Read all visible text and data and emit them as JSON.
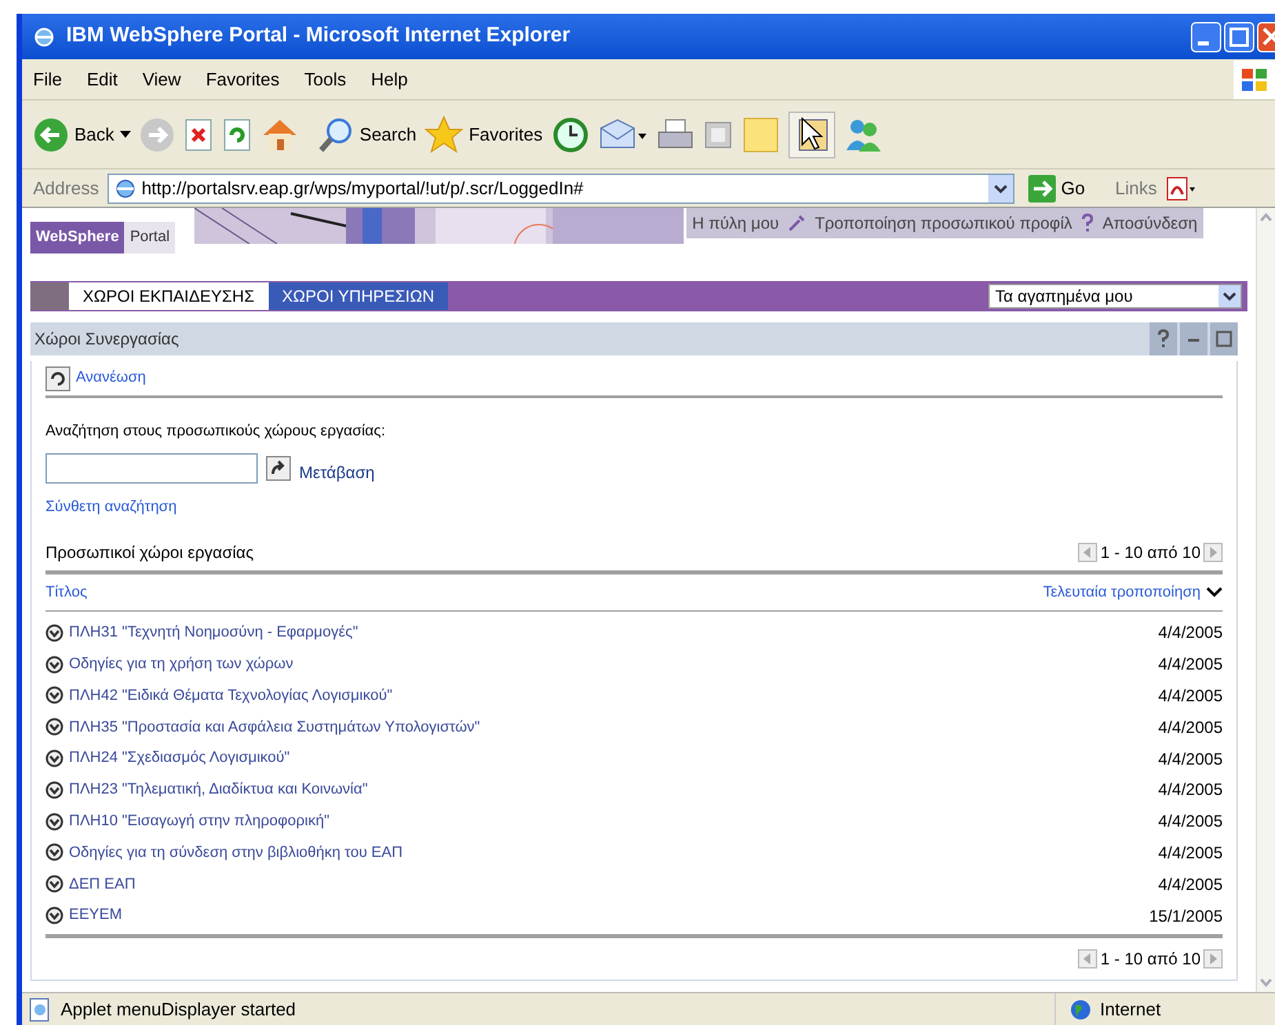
{
  "window": {
    "title": "IBM WebSphere Portal - Microsoft Internet Explorer"
  },
  "menu": [
    "File",
    "Edit",
    "View",
    "Favorites",
    "Tools",
    "Help"
  ],
  "toolbar": {
    "back": "Back",
    "search": "Search",
    "favorites": "Favorites"
  },
  "address_bar": {
    "label": "Address",
    "url": "http://portalsrv.eap.gr/wps/myportal/!ut/p/.scr/LoggedIn#",
    "go": "Go",
    "links": "Links"
  },
  "portal": {
    "brand": [
      "WebSphere",
      "Portal"
    ],
    "nav_links": [
      "Η πύλη μου",
      "Τροποποίηση προσωπικού προφίλ",
      "Αποσύνδεση"
    ],
    "tabs": [
      {
        "label": "ΧΩΡΟΙ ΕΚΠΑΙΔΕΥΣΗΣ",
        "selected": true
      },
      {
        "label": "ΧΩΡΟΙ ΥΠΗΡΕΣΙΩΝ",
        "selected": false
      }
    ],
    "favorites_dropdown": "Τα αγαπημένα μου"
  },
  "portlet": {
    "title": "Χώροι Συνεργασίας",
    "refresh": "Ανανέωση",
    "search_label": "Αναζήτηση στους προσωπικούς χώρους εργασίας:",
    "go": "Μετάβαση",
    "advanced_search": "Σύνθετη αναζήτηση",
    "section_title": "Προσωπικοί χώροι εργασίας",
    "pager_top": "1 - 10 από 10",
    "pager_bottom": "1 - 10 από 10",
    "columns": [
      "Τίτλος",
      "Τελευταία τροποποίηση"
    ],
    "rows": [
      {
        "title": "ΠΛΗ31 \"Τεχνητή Νοημοσύνη - Εφαρμογές\"",
        "modified": "4/4/2005"
      },
      {
        "title": "Οδηγίες για τη χρήση των χώρων",
        "modified": "4/4/2005"
      },
      {
        "title": "ΠΛΗ42 \"Ειδικά Θέματα Τεχνολογίας Λογισμικού\"",
        "modified": "4/4/2005"
      },
      {
        "title": "ΠΛΗ35 \"Προστασία και Ασφάλεια Συστημάτων Υπολογιστών\"",
        "modified": "4/4/2005"
      },
      {
        "title": "ΠΛΗ24 \"Σχεδιασμός Λογισμικού\"",
        "modified": "4/4/2005"
      },
      {
        "title": "ΠΛΗ23 \"Τηλεματική, Διαδίκτυα και Κοινωνία\"",
        "modified": "4/4/2005"
      },
      {
        "title": "ΠΛΗ10 \"Εισαγωγή στην πληροφορική\"",
        "modified": "4/4/2005"
      },
      {
        "title": "Οδηγίες για τη σύνδεση στην βιβλιοθήκη του ΕΑΠ",
        "modified": "4/4/2005"
      },
      {
        "title": "ΔΕΠ ΕΑΠ",
        "modified": "4/4/2005"
      },
      {
        "title": "ΕΕΥΕΜ",
        "modified": "15/1/2005"
      }
    ]
  },
  "status_bar": {
    "text": "Applet menuDisplayer started",
    "zone": "Internet"
  }
}
